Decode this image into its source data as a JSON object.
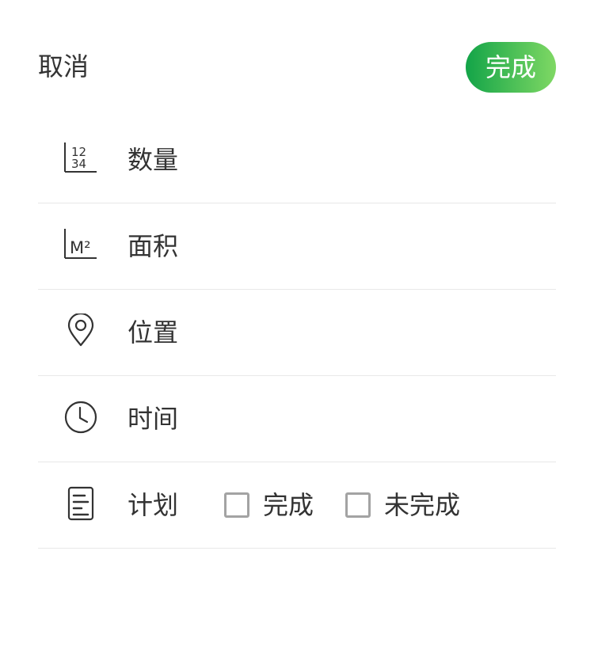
{
  "header": {
    "cancel_label": "取消",
    "done_label": "完成"
  },
  "rows": [
    {
      "label": "数量",
      "icon": "quantity-icon",
      "icon_text_top": "12",
      "icon_text_bottom": "34"
    },
    {
      "label": "面积",
      "icon": "area-icon",
      "icon_text": "M²"
    },
    {
      "label": "位置",
      "icon": "location-pin-icon"
    },
    {
      "label": "时间",
      "icon": "clock-icon"
    },
    {
      "label": "计划",
      "icon": "document-icon"
    }
  ],
  "plan_options": [
    {
      "label": "完成",
      "checked": false
    },
    {
      "label": "未完成",
      "checked": false
    }
  ],
  "colors": {
    "accent_start": "#13a448",
    "accent_end": "#7fd864",
    "text": "#333333",
    "divider": "#e8e8e8",
    "checkbox_border": "#a3a3a3"
  }
}
